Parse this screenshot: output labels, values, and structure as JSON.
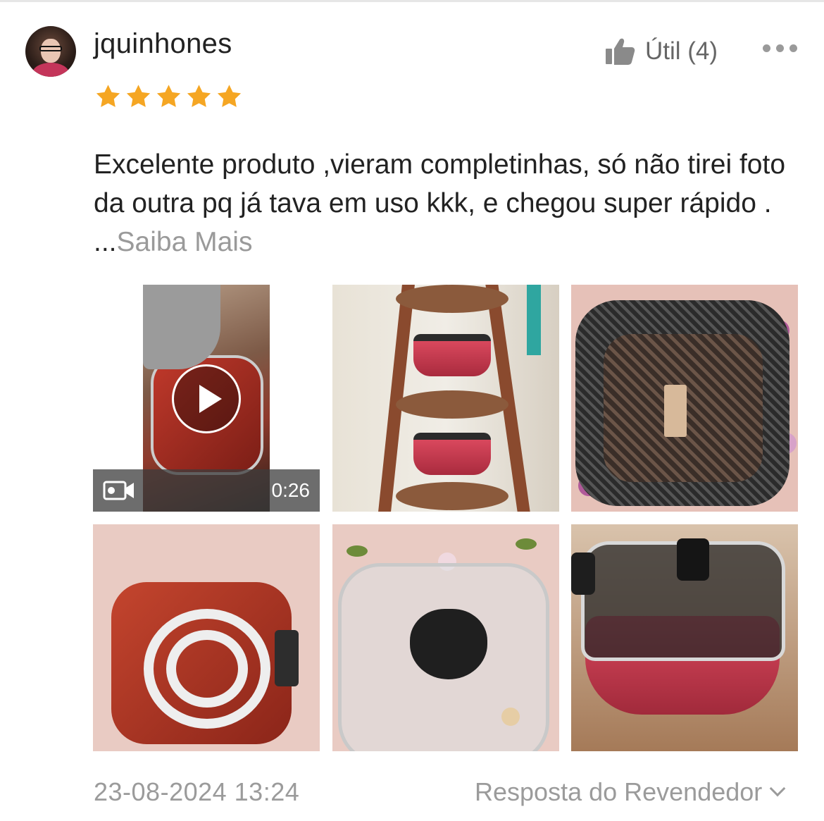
{
  "review": {
    "username": "jquinhones",
    "rating": 5,
    "helpful_label": "Útil (4)",
    "text": "Excelente produto ,vieram completinhas, só não tirei foto da outra pq já tava em uso kkk, e chegou super rápido . ...",
    "more_link": "Saiba Mais",
    "date": "23-08-2024 13:24",
    "seller_reply_label": "Resposta do Revendedor"
  },
  "media": {
    "video_duration": "0:26",
    "items": [
      "video",
      "photo",
      "photo",
      "photo",
      "photo",
      "photo"
    ]
  },
  "icons": {
    "helpful": "thumbs-up-icon",
    "more": "more-options-icon",
    "star": "star-icon",
    "video": "video-camera-icon",
    "play": "play-icon",
    "chevron": "chevron-down-icon"
  },
  "colors": {
    "star": "#f5a623",
    "muted_text": "#9b9b9b",
    "primary_text": "#222222"
  }
}
